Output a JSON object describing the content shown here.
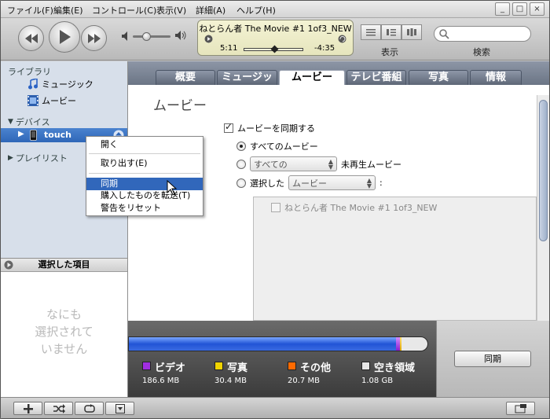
{
  "menu": [
    "ファイル(F)",
    "編集(E)",
    "コントロール(C)",
    "表示(V)",
    "詳細(A)",
    "ヘルプ(H)"
  ],
  "window_buttons": {
    "minimize": "_",
    "maximize": "□",
    "close": "×"
  },
  "player": {
    "track": "ねとらん者 The Movie #1 1of3_NEW",
    "elapsed": "5:11",
    "remaining": "-4:35",
    "progress": 0.53,
    "volume": 0.35
  },
  "view_label": "表示",
  "search_label": "検索",
  "sidebar": {
    "library_header": "ライブラリ",
    "library_items": [
      "ミュージック",
      "ムービー"
    ],
    "devices_header": "デバイス",
    "device_name": "touch",
    "playlist_header": "プレイリスト"
  },
  "selected_panel": {
    "title": "選択した項目",
    "empty_line1": "なにも",
    "empty_line2": "選択されて",
    "empty_line3": "いません"
  },
  "tabs": [
    "概要",
    "ミュージック",
    "ムービー",
    "テレビ番組",
    "写真",
    "情報"
  ],
  "active_tab": "ムービー",
  "content": {
    "title": "ムービー",
    "sync_checkbox": "ムービーを同期する",
    "opt_all": "すべてのムービー",
    "opt_unplayed_select": "すべての",
    "opt_unplayed_suffix": "未再生ムービー",
    "opt_selected": "選択した",
    "opt_selected_select": "ムービー",
    "opt_selected_colon": ":",
    "list_item": "ねとらん者 The Movie #1 1of3_NEW"
  },
  "context_menu": {
    "items": [
      "開く",
      "取り出す(E)",
      "同期",
      "購入したものを転送(T)",
      "警告をリセット"
    ],
    "highlighted": "同期"
  },
  "capacity": {
    "legend": [
      {
        "name": "ビデオ",
        "size": "186.6 MB",
        "color": "#a02ee0"
      },
      {
        "name": "写真",
        "size": "30.4 MB",
        "color": "#f1d400"
      },
      {
        "name": "その他",
        "size": "20.7 MB",
        "color": "#ff6a00"
      },
      {
        "name": "空き領域",
        "size": "1.08 GB",
        "color": "#e6e6e6"
      }
    ]
  },
  "sync_button": "同期"
}
